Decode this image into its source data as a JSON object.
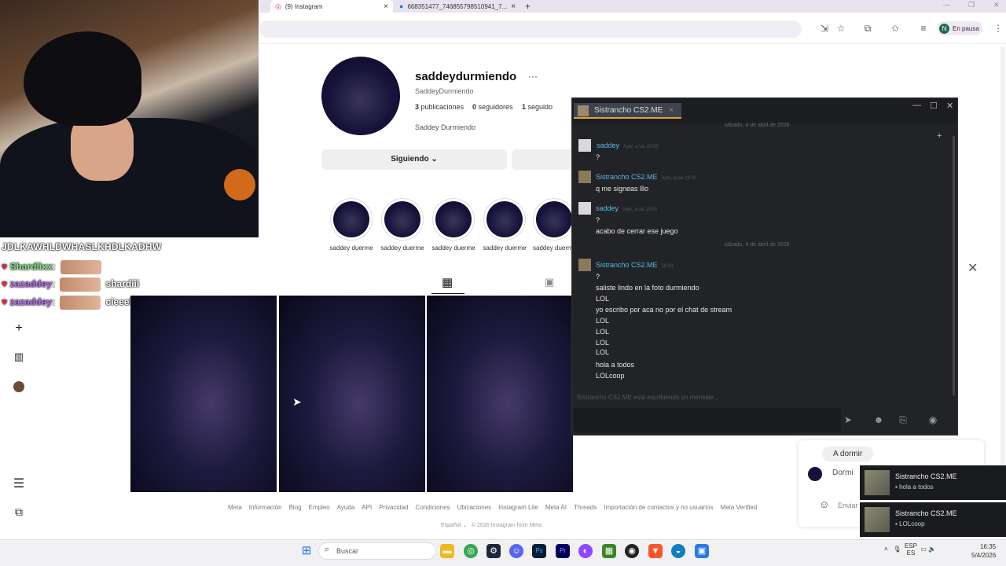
{
  "browser": {
    "tabs": [
      {
        "label": "(9) Instagram"
      },
      {
        "label": "668351477_746855798510941_7..."
      }
    ],
    "profile_status": "En pausa",
    "profile_initial": "N"
  },
  "stream_chat": {
    "top_message": "JDLKAWHLDWHASLKHDLKADHW",
    "rows": [
      {
        "user": "Shardiixx",
        "message": ""
      },
      {
        "user": "zazaddey",
        "message": "shardiii"
      },
      {
        "user": "zazaddey",
        "message": "cieeeliiiiiiin"
      }
    ]
  },
  "instagram": {
    "username": "saddeydurmiendo",
    "handle": "SaddeyDurmiendo",
    "stats": {
      "posts_count": "3",
      "posts_label": "publicaciones",
      "followers_count": "0",
      "followers_label": "seguidores",
      "following_count": "1",
      "following_label": "seguido"
    },
    "full_name": "Saddey Durmiendo",
    "follow_button": "Siguiendo",
    "highlights": [
      "saddey duerme",
      "saddey duerme",
      "saddey duerme",
      "saddey duerme",
      "saddey duerm"
    ],
    "footer_links": [
      "Meta",
      "Información",
      "Blog",
      "Empleo",
      "Ayuda",
      "API",
      "Privacidad",
      "Condiciones",
      "Ubicaciones",
      "Instagram Lite",
      "Meta AI",
      "Threads",
      "Importación de contactos y no usuarios",
      "Meta Verified"
    ],
    "footer_lang": "Español",
    "footer_copy": "© 2026 Instagram from Meta",
    "dm": {
      "bubble": "A dormir",
      "name": "Dormi",
      "send": "Enviar"
    }
  },
  "steam_chat": {
    "tab_title": "Sistrancho CS2.ME",
    "separator_1": "sábado, 4 de abril de 2026",
    "separator_2": "sábado, 4 de abril de 2026",
    "messages": [
      {
        "name": "saddey",
        "time": "Ayer, a las 23:05",
        "lines": [
          "?"
        ]
      },
      {
        "name": "Sistrancho CS2.ME",
        "time": "Ayer, a las 23:05",
        "lines": [
          "q me signeas lllo"
        ]
      },
      {
        "name": "saddey",
        "time": "Ayer, a las 23:05",
        "lines": [
          "?",
          "acabo de cerrar ese juego"
        ]
      },
      {
        "name": "Sistrancho CS2.ME",
        "time": "16:33",
        "lines": [
          "?",
          "saliste lindo en la foto durmiendo",
          "LOL",
          "yo escribo por aca no por el chat de stream",
          "LOL",
          "LOL",
          "LOL",
          "LOL",
          "hola a todos",
          "LOLcoop"
        ]
      }
    ],
    "typing": "Sistrancho CS2.ME está escribiendo un mensaje..."
  },
  "notifications": [
    {
      "name": "Sistrancho CS2.ME",
      "message": "hola a todos"
    },
    {
      "name": "Sistrancho CS2.ME",
      "message": "LOLcoop"
    }
  ],
  "taskbar": {
    "search_placeholder": "Buscar",
    "lang": "ESP",
    "lang2": "ES",
    "time": "16:35",
    "date": "5/4/2026"
  }
}
